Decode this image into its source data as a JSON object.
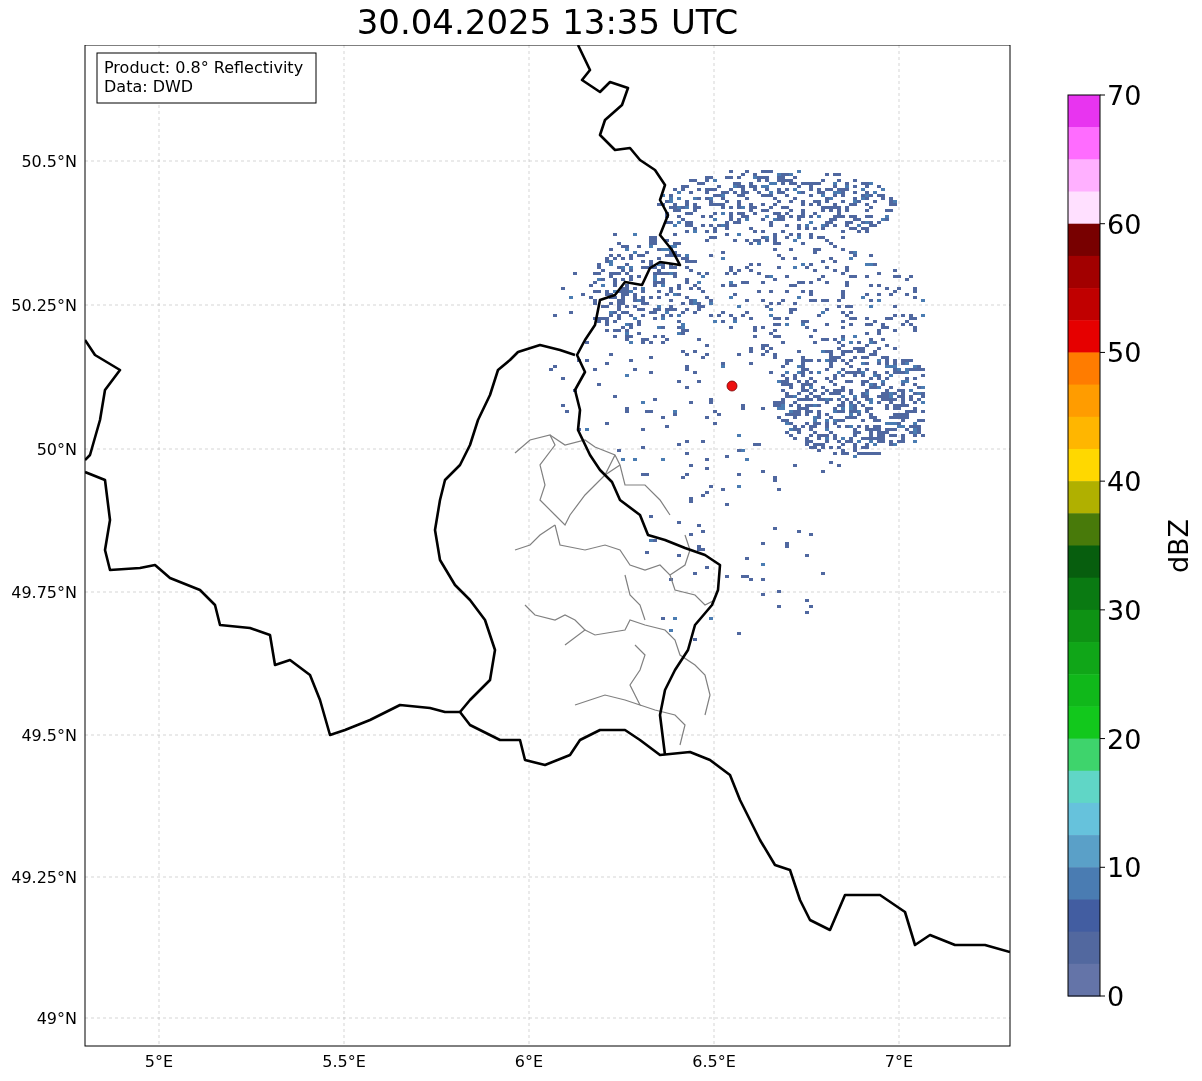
{
  "title": "30.04.2025 13:35 UTC",
  "info_box": {
    "lines": [
      "Product: 0.8° Reflectivity",
      "Data: DWD"
    ]
  },
  "map": {
    "lat_ticks": [
      "50.5°N",
      "50.25°N",
      "50°N",
      "49.75°N",
      "49.5°N",
      "49.25°N",
      "49°N"
    ],
    "lon_ticks": [
      "5°E",
      "5.5°E",
      "6°E",
      "6.5°E",
      "7°E"
    ]
  },
  "colorbar": {
    "label": "dBZ",
    "ticks": [
      "70",
      "60",
      "50",
      "40",
      "30",
      "20",
      "10",
      "0"
    ],
    "segments": [
      {
        "color": "#e834f0"
      },
      {
        "color": "#ff6cff"
      },
      {
        "color": "#ffb0ff"
      },
      {
        "color": "#ffe0ff"
      },
      {
        "color": "#780000"
      },
      {
        "color": "#a20000"
      },
      {
        "color": "#c00000"
      },
      {
        "color": "#e60000"
      },
      {
        "color": "#ff7c00"
      },
      {
        "color": "#ff9c00"
      },
      {
        "color": "#ffb600"
      },
      {
        "color": "#ffd800"
      },
      {
        "color": "#b0b000"
      },
      {
        "color": "#487a0a"
      },
      {
        "color": "#075e0e"
      },
      {
        "color": "#0a7a12"
      },
      {
        "color": "#0e9214"
      },
      {
        "color": "#10a618"
      },
      {
        "color": "#10b81a"
      },
      {
        "color": "#12c81c"
      },
      {
        "color": "#3ed46c"
      },
      {
        "color": "#60d6c6"
      },
      {
        "color": "#66c2dc"
      },
      {
        "color": "#5aa0c8"
      },
      {
        "color": "#4a7cb2"
      },
      {
        "color": "#425da1"
      },
      {
        "color": "#52689f"
      },
      {
        "color": "#6474a8"
      }
    ]
  }
}
